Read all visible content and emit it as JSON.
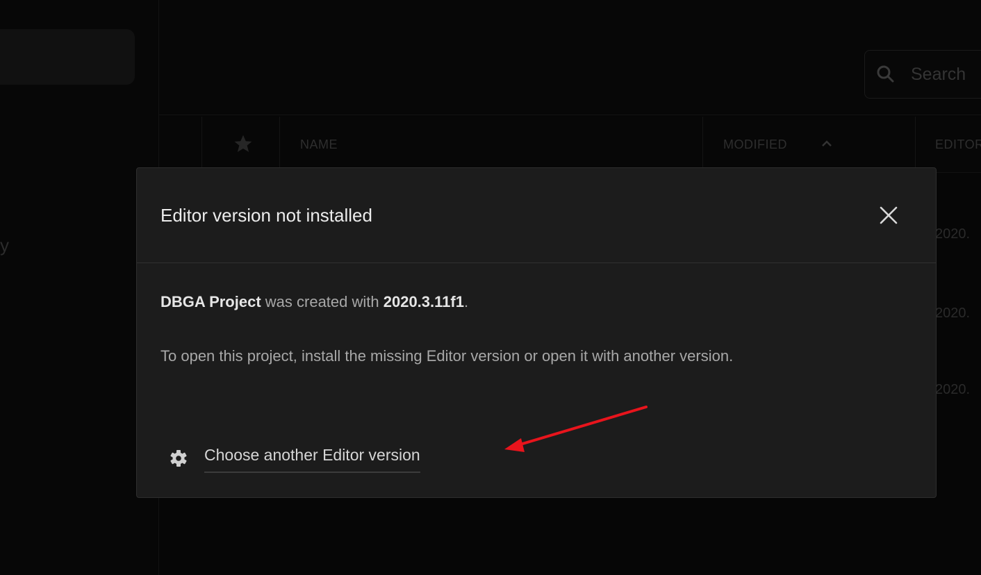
{
  "background": {
    "sidebar_partial_text": "y",
    "search_placeholder": "Search",
    "table_headers": {
      "name": "NAME",
      "modified": "MODIFIED",
      "editor": "EDITOR"
    },
    "row_versions": [
      "2020.",
      "2020.",
      "2020."
    ]
  },
  "dialog": {
    "title": "Editor version not installed",
    "project_name": "DBGA Project",
    "created_with_text": " was created with ",
    "version": "2020.3.11f1",
    "period": ".",
    "instruction": "To open this project, install the missing Editor version or open it with another version.",
    "choose_link_label": "Choose another Editor version"
  },
  "colors": {
    "annotation_arrow": "#e8141c",
    "dialog_bg": "#1c1c1c",
    "overlay_bg": "#060606"
  },
  "icons": {
    "close": "close-icon",
    "gear": "gear-icon",
    "search": "search-icon",
    "star": "star-icon",
    "sort": "chevron-up-icon"
  }
}
